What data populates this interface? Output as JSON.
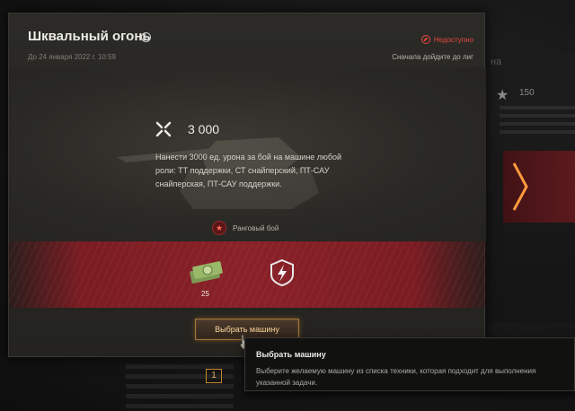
{
  "dialog": {
    "title": "Шквальный огонь",
    "date": "До 24 января 2022 г. 10:59",
    "status": "Недоступно",
    "hint_right": "Сначала дойдите до лиг"
  },
  "task": {
    "value": "3 000",
    "description": "Нанести 3000 ед. урона за бой на машине любой роли: ТТ поддержки, СТ снайперский, ПТ-САУ снайперская, ПТ-САУ поддержки.",
    "battle_type": "Ранговый бой"
  },
  "rewards": {
    "money_count": "25"
  },
  "button": {
    "label": "Выбрать машину"
  },
  "tooltip": {
    "title": "Выбрать машину",
    "text": "Выберите желаемую машину из списка техники, которая подходит для выполнения указанной задачи."
  },
  "background": {
    "top_text": "на",
    "star_value": "150",
    "page_number": "1"
  },
  "colors": {
    "accent": "#c9862b",
    "unavailable": "#e84a3c",
    "reward_band": "#8a2128"
  }
}
